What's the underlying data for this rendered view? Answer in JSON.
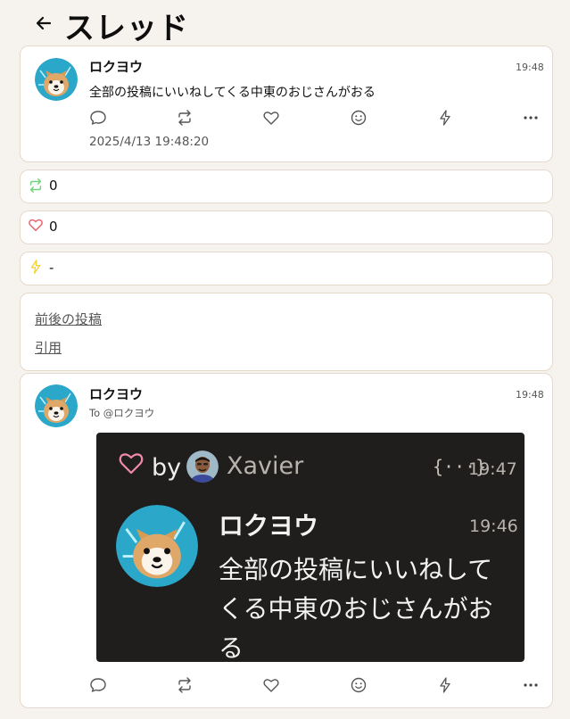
{
  "header": {
    "title": "スレッド"
  },
  "note": {
    "username": "ロクヨウ",
    "time": "19:48",
    "text": "全部の投稿にいいねしてくる中東のおじさんがおる",
    "datetime": "2025/4/13 19:48:20"
  },
  "stats": {
    "renotes": "0",
    "reactions": "0",
    "clips": "-"
  },
  "links": {
    "around": "前後の投稿",
    "quote": "引用"
  },
  "reply": {
    "username": "ロクヨウ",
    "time": "19:48",
    "reply_to": "To @ロクヨウ",
    "embed": {
      "by": "by",
      "renoter": "Xavier",
      "braces": "{···}",
      "time_top": "19:47",
      "username": "ロクヨウ",
      "time": "19:46",
      "text": "全部の投稿にいいねしてくる中東のおじさんがおる"
    }
  },
  "colors": {
    "background": "#f6f2ed",
    "renote": "#6fd47d",
    "heart": "#e8606b",
    "bolt": "#f2d23a"
  }
}
